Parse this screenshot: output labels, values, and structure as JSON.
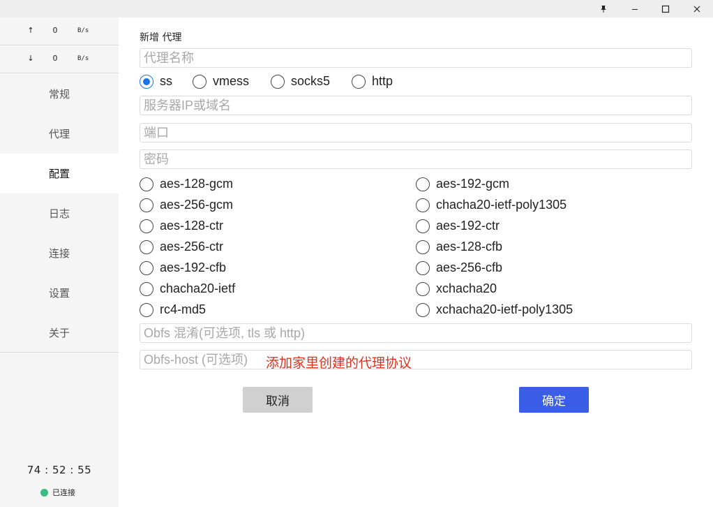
{
  "window": {
    "pin_icon": "pin-icon",
    "minimize_icon": "minimize-icon",
    "maximize_icon": "maximize-icon",
    "close_icon": "close-icon"
  },
  "sidebar": {
    "upload": {
      "arrow": "↑",
      "value": "0",
      "unit": "B/s"
    },
    "download": {
      "arrow": "↓",
      "value": "0",
      "unit": "B/s"
    },
    "nav": [
      {
        "label": "常规"
      },
      {
        "label": "代理"
      },
      {
        "label": "配置"
      },
      {
        "label": "日志"
      },
      {
        "label": "连接"
      },
      {
        "label": "设置"
      },
      {
        "label": "关于"
      }
    ],
    "active_nav": "配置",
    "timer": "74 : 52 : 55",
    "status_text": "已连接",
    "status_color": "#3dba7d"
  },
  "form": {
    "title": "新增 代理",
    "name_placeholder": "代理名称",
    "protocols": [
      "ss",
      "vmess",
      "socks5",
      "http"
    ],
    "selected_protocol": "ss",
    "server_placeholder": "服务器IP或域名",
    "port_placeholder": "端口",
    "password_placeholder": "密码",
    "ciphers_left": [
      "aes-128-gcm",
      "aes-256-gcm",
      "aes-128-ctr",
      "aes-256-ctr",
      "aes-192-cfb",
      "chacha20-ietf",
      "rc4-md5"
    ],
    "ciphers_right": [
      "aes-192-gcm",
      "chacha20-ietf-poly1305",
      "aes-192-ctr",
      "aes-128-cfb",
      "aes-256-cfb",
      "xchacha20",
      "xchacha20-ietf-poly1305"
    ],
    "obfs_placeholder": "Obfs 混淆(可选项, tls 或 http)",
    "obfs_host_placeholder": "Obfs-host (可选项)",
    "annotation": "添加家里创建的代理协议",
    "cancel_label": "取消",
    "ok_label": "确定",
    "accent_color": "#3a5ee8"
  }
}
